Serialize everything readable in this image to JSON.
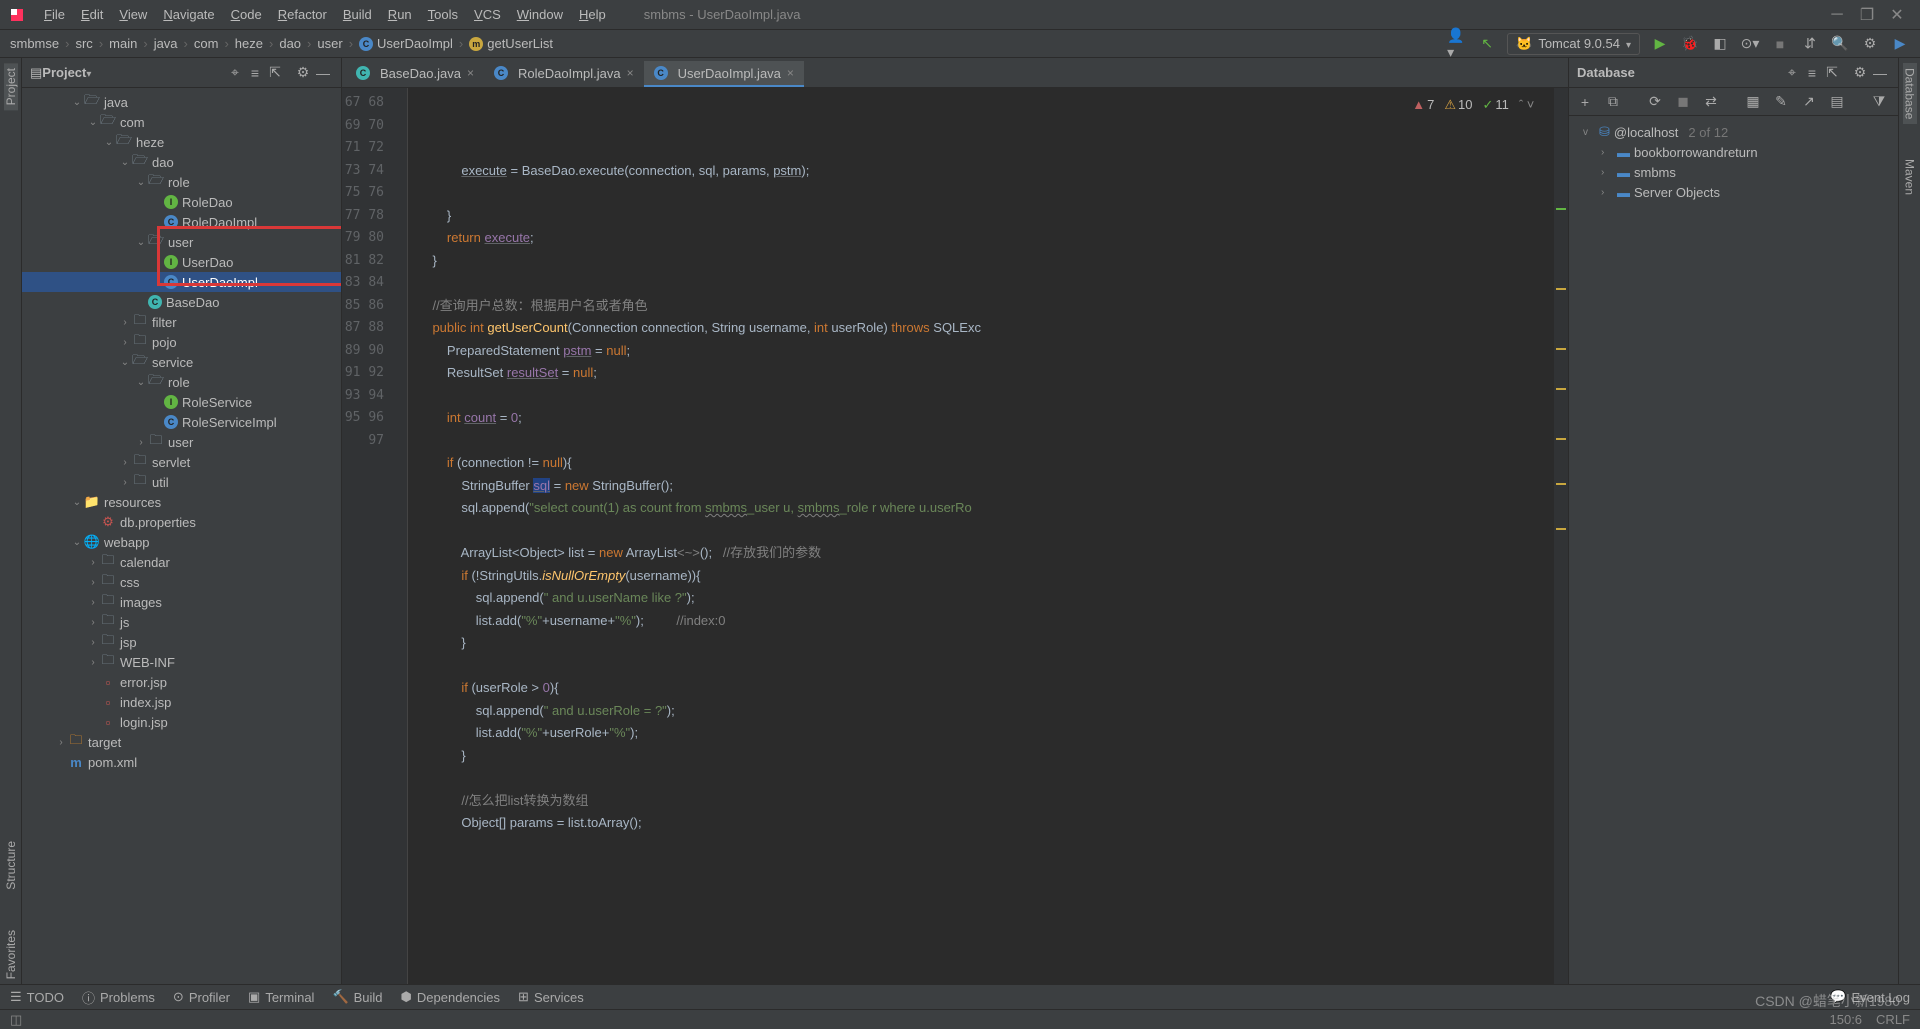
{
  "menubar": {
    "items": [
      "File",
      "Edit",
      "View",
      "Navigate",
      "Code",
      "Refactor",
      "Build",
      "Run",
      "Tools",
      "VCS",
      "Window",
      "Help"
    ],
    "title": "smbms - UserDaoImpl.java"
  },
  "breadcrumb": [
    "smbmse",
    "src",
    "main",
    "java",
    "com",
    "heze",
    "dao",
    "user",
    "UserDaoImpl",
    "getUserList"
  ],
  "tomcat": "Tomcat 9.0.54",
  "project": {
    "title": "Project"
  },
  "tree": [
    {
      "d": 3,
      "exp": "v",
      "icon": "folder",
      "label": "java"
    },
    {
      "d": 4,
      "exp": "v",
      "icon": "folder",
      "label": "com"
    },
    {
      "d": 5,
      "exp": "v",
      "icon": "folder",
      "label": "heze"
    },
    {
      "d": 6,
      "exp": "v",
      "icon": "folder",
      "label": "dao"
    },
    {
      "d": 7,
      "exp": "v",
      "icon": "folder",
      "label": "role"
    },
    {
      "d": 8,
      "exp": "",
      "icon": "i-green",
      "label": "RoleDao"
    },
    {
      "d": 8,
      "exp": "",
      "icon": "c-blue",
      "label": "RoleDaoImpl"
    },
    {
      "d": 7,
      "exp": "v",
      "icon": "folder",
      "label": "user"
    },
    {
      "d": 8,
      "exp": "",
      "icon": "i-green",
      "label": "UserDao"
    },
    {
      "d": 8,
      "exp": "",
      "icon": "c-blue",
      "label": "UserDaoImpl",
      "selected": true
    },
    {
      "d": 7,
      "exp": "",
      "icon": "c-cyan",
      "label": "BaseDao"
    },
    {
      "d": 6,
      "exp": ">",
      "icon": "folder",
      "label": "filter"
    },
    {
      "d": 6,
      "exp": ">",
      "icon": "folder",
      "label": "pojo"
    },
    {
      "d": 6,
      "exp": "v",
      "icon": "folder",
      "label": "service"
    },
    {
      "d": 7,
      "exp": "v",
      "icon": "folder",
      "label": "role"
    },
    {
      "d": 8,
      "exp": "",
      "icon": "i-green",
      "label": "RoleService"
    },
    {
      "d": 8,
      "exp": "",
      "icon": "c-blue",
      "label": "RoleServiceImpl"
    },
    {
      "d": 7,
      "exp": ">",
      "icon": "folder",
      "label": "user"
    },
    {
      "d": 6,
      "exp": ">",
      "icon": "folder",
      "label": "servlet"
    },
    {
      "d": 6,
      "exp": ">",
      "icon": "folder",
      "label": "util"
    },
    {
      "d": 3,
      "exp": "v",
      "icon": "res",
      "label": "resources"
    },
    {
      "d": 4,
      "exp": "",
      "icon": "prop",
      "label": "db.properties"
    },
    {
      "d": 3,
      "exp": "v",
      "icon": "web",
      "label": "webapp"
    },
    {
      "d": 4,
      "exp": ">",
      "icon": "folder",
      "label": "calendar"
    },
    {
      "d": 4,
      "exp": ">",
      "icon": "folder",
      "label": "css"
    },
    {
      "d": 4,
      "exp": ">",
      "icon": "folder",
      "label": "images"
    },
    {
      "d": 4,
      "exp": ">",
      "icon": "folder",
      "label": "js"
    },
    {
      "d": 4,
      "exp": ">",
      "icon": "folder",
      "label": "jsp"
    },
    {
      "d": 4,
      "exp": ">",
      "icon": "folder",
      "label": "WEB-INF"
    },
    {
      "d": 4,
      "exp": "",
      "icon": "jsp",
      "label": "error.jsp"
    },
    {
      "d": 4,
      "exp": "",
      "icon": "jsp",
      "label": "index.jsp"
    },
    {
      "d": 4,
      "exp": "",
      "icon": "jsp",
      "label": "login.jsp"
    },
    {
      "d": 2,
      "exp": ">",
      "icon": "target",
      "label": "target"
    },
    {
      "d": 2,
      "exp": "",
      "icon": "pom",
      "label": "pom.xml"
    }
  ],
  "tabs": [
    {
      "label": "BaseDao.java",
      "icon": "c-cyan"
    },
    {
      "label": "RoleDaoImpl.java",
      "icon": "c-blue"
    },
    {
      "label": "UserDaoImpl.java",
      "icon": "c-blue",
      "active": true
    }
  ],
  "inspections": {
    "err": "7",
    "warn": "10",
    "ok": "11"
  },
  "lines": {
    "start": 67,
    "end": 97
  },
  "code": [
    "            <span class='u'>execute</span> = BaseDao.execute(connection, sql, params, <span class='u'>pstm</span>);",
    "",
    "        }",
    "        <span class='k'>return</span> <span class='u id'>execute</span>;",
    "    }",
    "",
    "    <span class='cmz'>//查询用户总数：根据用户名或者角色</span>",
    "    <span class='k'>public</span> <span class='k'>int</span> <span class='fn'>getUserCount</span>(Connection connection, String username, <span class='k'>int</span> userRole) <span class='k'>throws</span> SQLExc",
    "        PreparedStatement <span class='u id'>pstm</span> = <span class='k'>null</span>;",
    "        ResultSet <span class='u id'>resultSet</span> = <span class='k'>null</span>;",
    "",
    "        <span class='k'>int</span> <span class='u id'>count</span> = <span class='id'>0</span>;",
    "",
    "        <span class='k'>if</span> (connection != <span class='k'>null</span>){",
    "            StringBuffer <span class='hl u id'>sql</span> = <span class='k'>new</span> StringBuffer();",
    "            sql.append(<span class='s'>\"select count(1) as count from <span class='wav'>smbms</span>_user u, <span class='wav'>smbms</span>_role r where u.userRo</span>",
    "",
    "            ArrayList&lt;Object&gt; list = <span class='k'>new</span> ArrayList<span class='c'>&lt;~&gt;</span>();   <span class='cmz'>//存放我们的参数</span>",
    "            <span class='k'>if</span> (!StringUtils.<span class='fn'><i>isNullOrEmpty</i></span>(username)){",
    "                sql.append(<span class='s'>\" and u.userName like ?\"</span>);",
    "                list.add(<span class='s'>\"%\"</span>+username+<span class='s'>\"%\"</span>);         <span class='cmz'>//index:0</span>",
    "            }",
    "",
    "            <span class='k'>if</span> (userRole &gt; <span class='id'>0</span>){",
    "                sql.append(<span class='s'>\" and u.userRole = ?\"</span>);",
    "                list.add(<span class='s'>\"%\"</span>+userRole+<span class='s'>\"%\"</span>);",
    "            }",
    "",
    "            <span class='cmz'>//怎么把list转换为数组</span>",
    "            Object[] params = list.toArray();",
    ""
  ],
  "db": {
    "title": "Database",
    "host": "@localhost",
    "count": "2 of 12",
    "items": [
      "bookborrowandreturn",
      "smbms",
      "Server Objects"
    ]
  },
  "bottom": [
    "TODO",
    "Problems",
    "Profiler",
    "Terminal",
    "Build",
    "Dependencies",
    "Services"
  ],
  "bottom_right": "Event Log",
  "status": {
    "pos": "150:6",
    "enc": "CRLF",
    "watermark": "CSDN @蜡笔小新1980"
  },
  "left_tabs": [
    "Project",
    "Structure",
    "Favorites"
  ],
  "right_tabs": [
    "Database",
    "Maven"
  ]
}
